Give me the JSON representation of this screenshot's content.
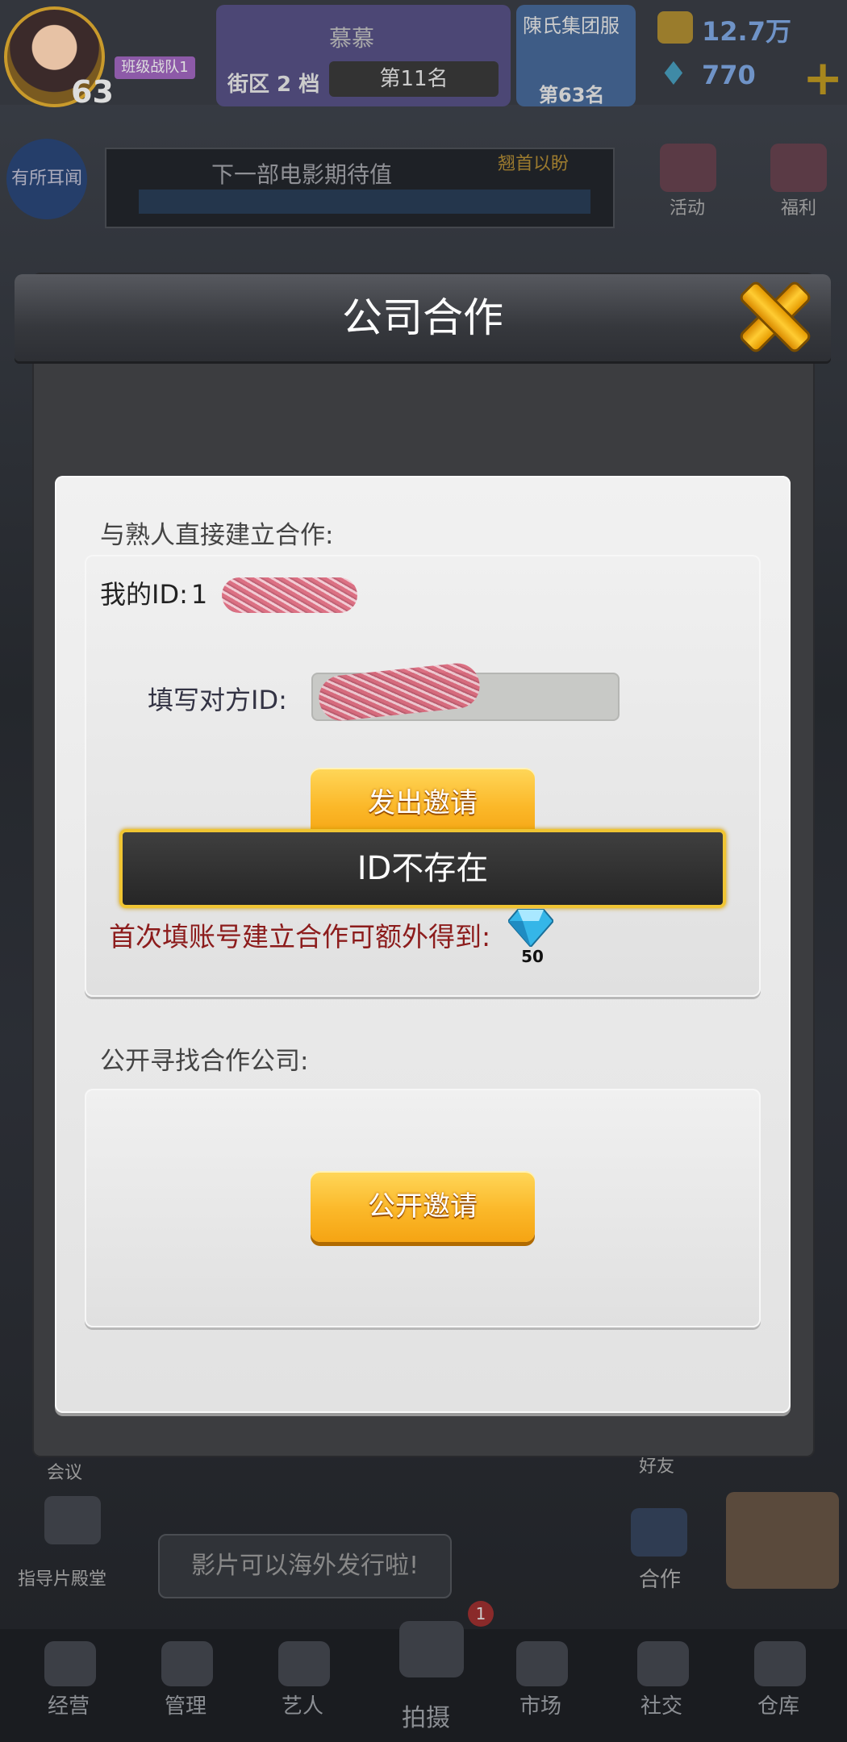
{
  "background": {
    "player_level": "63",
    "player_tag": "班级战队1",
    "district": {
      "name": "慕慕",
      "label": "街区 2 档",
      "rank": "第11名"
    },
    "guild": {
      "name": "陳氏集团服",
      "rank": "第63名"
    },
    "currency": {
      "coins": "12.7万",
      "gems": "770"
    },
    "left_circle_label": "有所耳闻",
    "movie_bar": {
      "title": "下一部电影期待值",
      "tag": "翘首以盼"
    },
    "side": {
      "activity": "活动",
      "welfare": "福利",
      "meeting": "会议",
      "friends": "好友",
      "coop": "合作",
      "director_hall": "指导片殿堂"
    },
    "tip": "影片可以海外发行啦!",
    "nav": [
      "经营",
      "管理",
      "艺人",
      "拍摄",
      "市场",
      "社交",
      "仓库"
    ],
    "nav_badge": "1"
  },
  "modal": {
    "title": "公司合作",
    "direct": {
      "section_label": "与熟人直接建立合作:",
      "my_id_label": "我的ID:",
      "my_id_visible": "1",
      "partner_id_label": "填写对方ID:",
      "send_button": "发出邀请",
      "bonus_text": "首次填账号建立合作可额外得到:",
      "bonus_amount": "50"
    },
    "public": {
      "section_label": "公开寻找合作公司:",
      "invite_button": "公开邀请"
    },
    "toast": "ID不存在"
  },
  "colors": {
    "accent_gold": "#fbb829",
    "toast_border": "#f0c533",
    "bonus_red": "#8c1c1c",
    "gem_blue": "#35b6e8"
  }
}
